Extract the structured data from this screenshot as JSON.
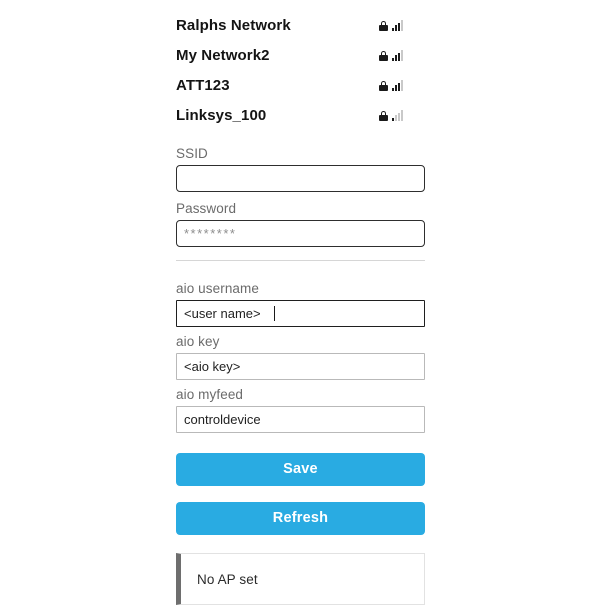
{
  "networks": {
    "items": [
      {
        "ssid": "Ralphs Network",
        "secured": true,
        "lock_icon": "lock-icon",
        "signal_icon": "signal-bars-icon",
        "signal_bars": 3,
        "signal_total": 4
      },
      {
        "ssid": "My Network2",
        "secured": true,
        "lock_icon": "lock-icon",
        "signal_icon": "signal-bars-icon",
        "signal_bars": 3,
        "signal_total": 4
      },
      {
        "ssid": "ATT123",
        "secured": true,
        "lock_icon": "lock-icon",
        "signal_icon": "signal-bars-icon",
        "signal_bars": 3,
        "signal_total": 4
      },
      {
        "ssid": "Linksys_100",
        "secured": true,
        "lock_icon": "lock-icon",
        "signal_icon": "signal-bars-icon",
        "signal_bars": 1,
        "signal_total": 4
      }
    ]
  },
  "wifi_form": {
    "ssid": {
      "label": "SSID",
      "value": "",
      "placeholder": ""
    },
    "password": {
      "label": "Password",
      "value": "********",
      "placeholder": ""
    }
  },
  "aio_form": {
    "username": {
      "label": "aio username",
      "value": "<user name>",
      "placeholder": ""
    },
    "key": {
      "label": "aio key",
      "value": "<aio key>",
      "placeholder": ""
    },
    "myfeed": {
      "label": "aio myfeed",
      "value": "controldevice",
      "placeholder": ""
    }
  },
  "actions": {
    "save_label": "Save",
    "refresh_label": "Refresh"
  },
  "status": {
    "message": "No AP set"
  },
  "colors": {
    "accent": "#29abe2",
    "button_text": "#ffffff",
    "label_text": "#6b6b6b",
    "network_text": "#141414",
    "alert_border": "#6e6e6e",
    "input_border_dark": "#1f1f1f",
    "input_border_light": "#b9b9b9"
  }
}
